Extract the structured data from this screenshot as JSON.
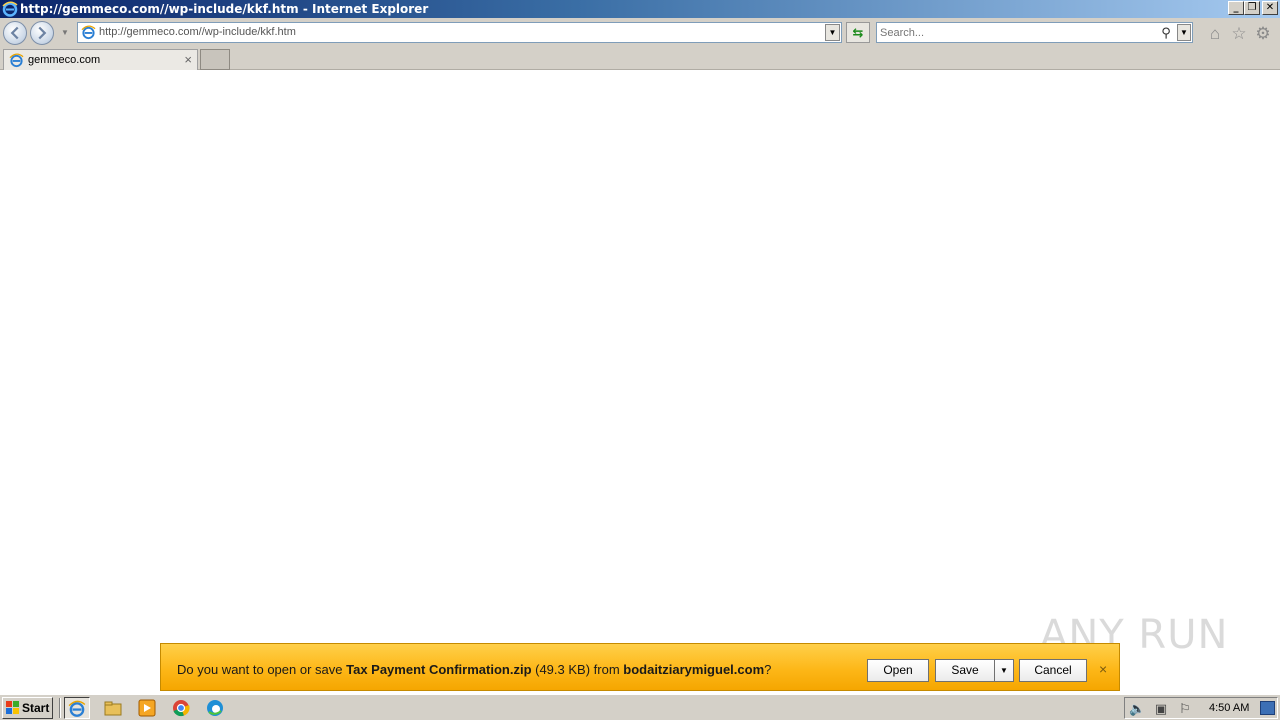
{
  "window": {
    "title": "http://gemmeco.com//wp-include/kkf.htm - Internet Explorer",
    "minimize_icon": "minimize-icon",
    "restore_icon": "restore-icon",
    "close_icon": "close-icon"
  },
  "toolbar": {
    "address_value": "http://gemmeco.com//wp-include/kkf.htm",
    "search_placeholder": "Search...",
    "icons": [
      "back-icon",
      "forward-icon",
      "home-icon",
      "favorites-star-icon",
      "gear-icon"
    ]
  },
  "tabs": [
    {
      "label": "gemmeco.com",
      "close": "×"
    }
  ],
  "download_bar": {
    "prefix": "Do you want to open or save ",
    "filename": "Tax Payment Confirmation.zip",
    "size": " (49.3 KB) from ",
    "source": "bodaitziarymiguel.com",
    "suffix": "?",
    "open_label": "Open",
    "save_label": "Save",
    "cancel_label": "Cancel",
    "close": "×",
    "bg_color": "#fdb718"
  },
  "watermark": {
    "text": "ANY RUN"
  },
  "taskbar": {
    "start_label": "Start",
    "apps": [
      "internet-explorer",
      "file-explorer",
      "media-player",
      "chrome",
      "edge"
    ],
    "clock": "4:50 AM"
  }
}
